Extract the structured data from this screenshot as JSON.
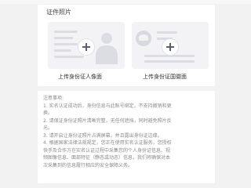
{
  "photo_section": {
    "title": "证件照片",
    "front": {
      "label": "上传身份证人像面",
      "placeholder_icon": "id-portrait-placeholder-icon",
      "add_icon": "plus-icon"
    },
    "back": {
      "label": "上传身份证国徽面",
      "placeholder_icon": "national-emblem-placeholder-icon",
      "add_icon": "plus-icon"
    }
  },
  "notes": {
    "title": "注意事项:",
    "lines": [
      "1. 实名认证成功后，身份信息与此账号绑定，不支持撤销和更",
      "换。",
      "2. 请保证身份证照片清晰完整，无任何遮挡，同时避免照片反",
      "光。",
      "3. 请开启让身份证照片占满屏幕，并且露出身份证边缘。",
      "4. 根据国家法律法规规定，您正在使用实名认证服务，您授权",
      "快手及合作方在实名认证过程中采集您的个人身份证信息、视",
      "频图像信息、面部特征（静态或动态）信息，我们将确保对本",
      "次采集到的信息履行相应的安全保障义务。"
    ]
  },
  "colors": {
    "background": "#f2f2f2",
    "card": "#ffffff",
    "placeholder": "#f3f3f5",
    "note_text": "#8a8a8a"
  }
}
